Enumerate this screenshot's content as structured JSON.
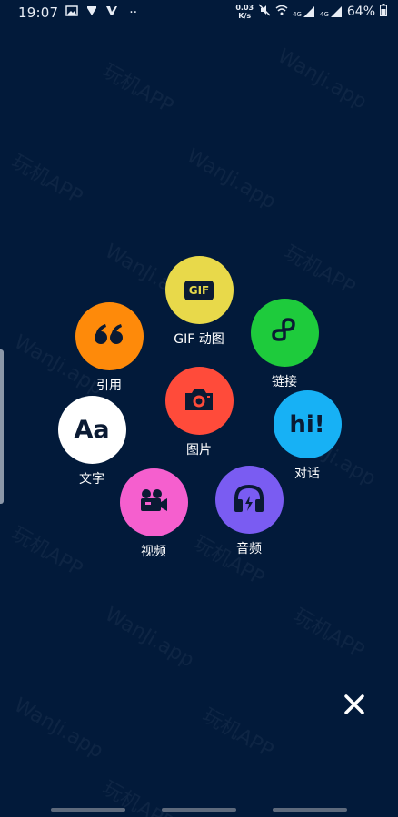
{
  "status_bar": {
    "time": "19:07",
    "dots": "··",
    "net_speed_value": "0.03",
    "net_speed_unit": "K/s",
    "signal1_label": "4G",
    "signal2_label": "4G",
    "battery": "64%"
  },
  "watermark": {
    "text_cn": "玩机APP",
    "text_en": "WanJi.app"
  },
  "menu": {
    "gif": {
      "label": "GIF 动图",
      "icon_text": "GIF",
      "color": "#e8d94a"
    },
    "quote": {
      "label": "引用",
      "icon_text": "66",
      "color": "#fe8a0a"
    },
    "link": {
      "label": "链接",
      "color": "#1ecb3c"
    },
    "image": {
      "label": "图片",
      "color": "#ff4b3a"
    },
    "hi": {
      "label": "对话",
      "icon_text": "hi!",
      "color": "#17b1f5"
    },
    "text": {
      "label": "文字",
      "icon_text": "Aa",
      "color": "#ffffff"
    },
    "video": {
      "label": "视频",
      "color": "#f55fce"
    },
    "audio": {
      "label": "音频",
      "color": "#7a5cf2"
    }
  },
  "icons": {
    "close": "close-icon",
    "gif": "gif-icon",
    "quote": "quote-icon",
    "link": "link-icon",
    "image": "camera-icon",
    "hi": "chat-icon",
    "text": "text-icon",
    "video": "video-camera-icon",
    "audio": "headphones-icon"
  }
}
